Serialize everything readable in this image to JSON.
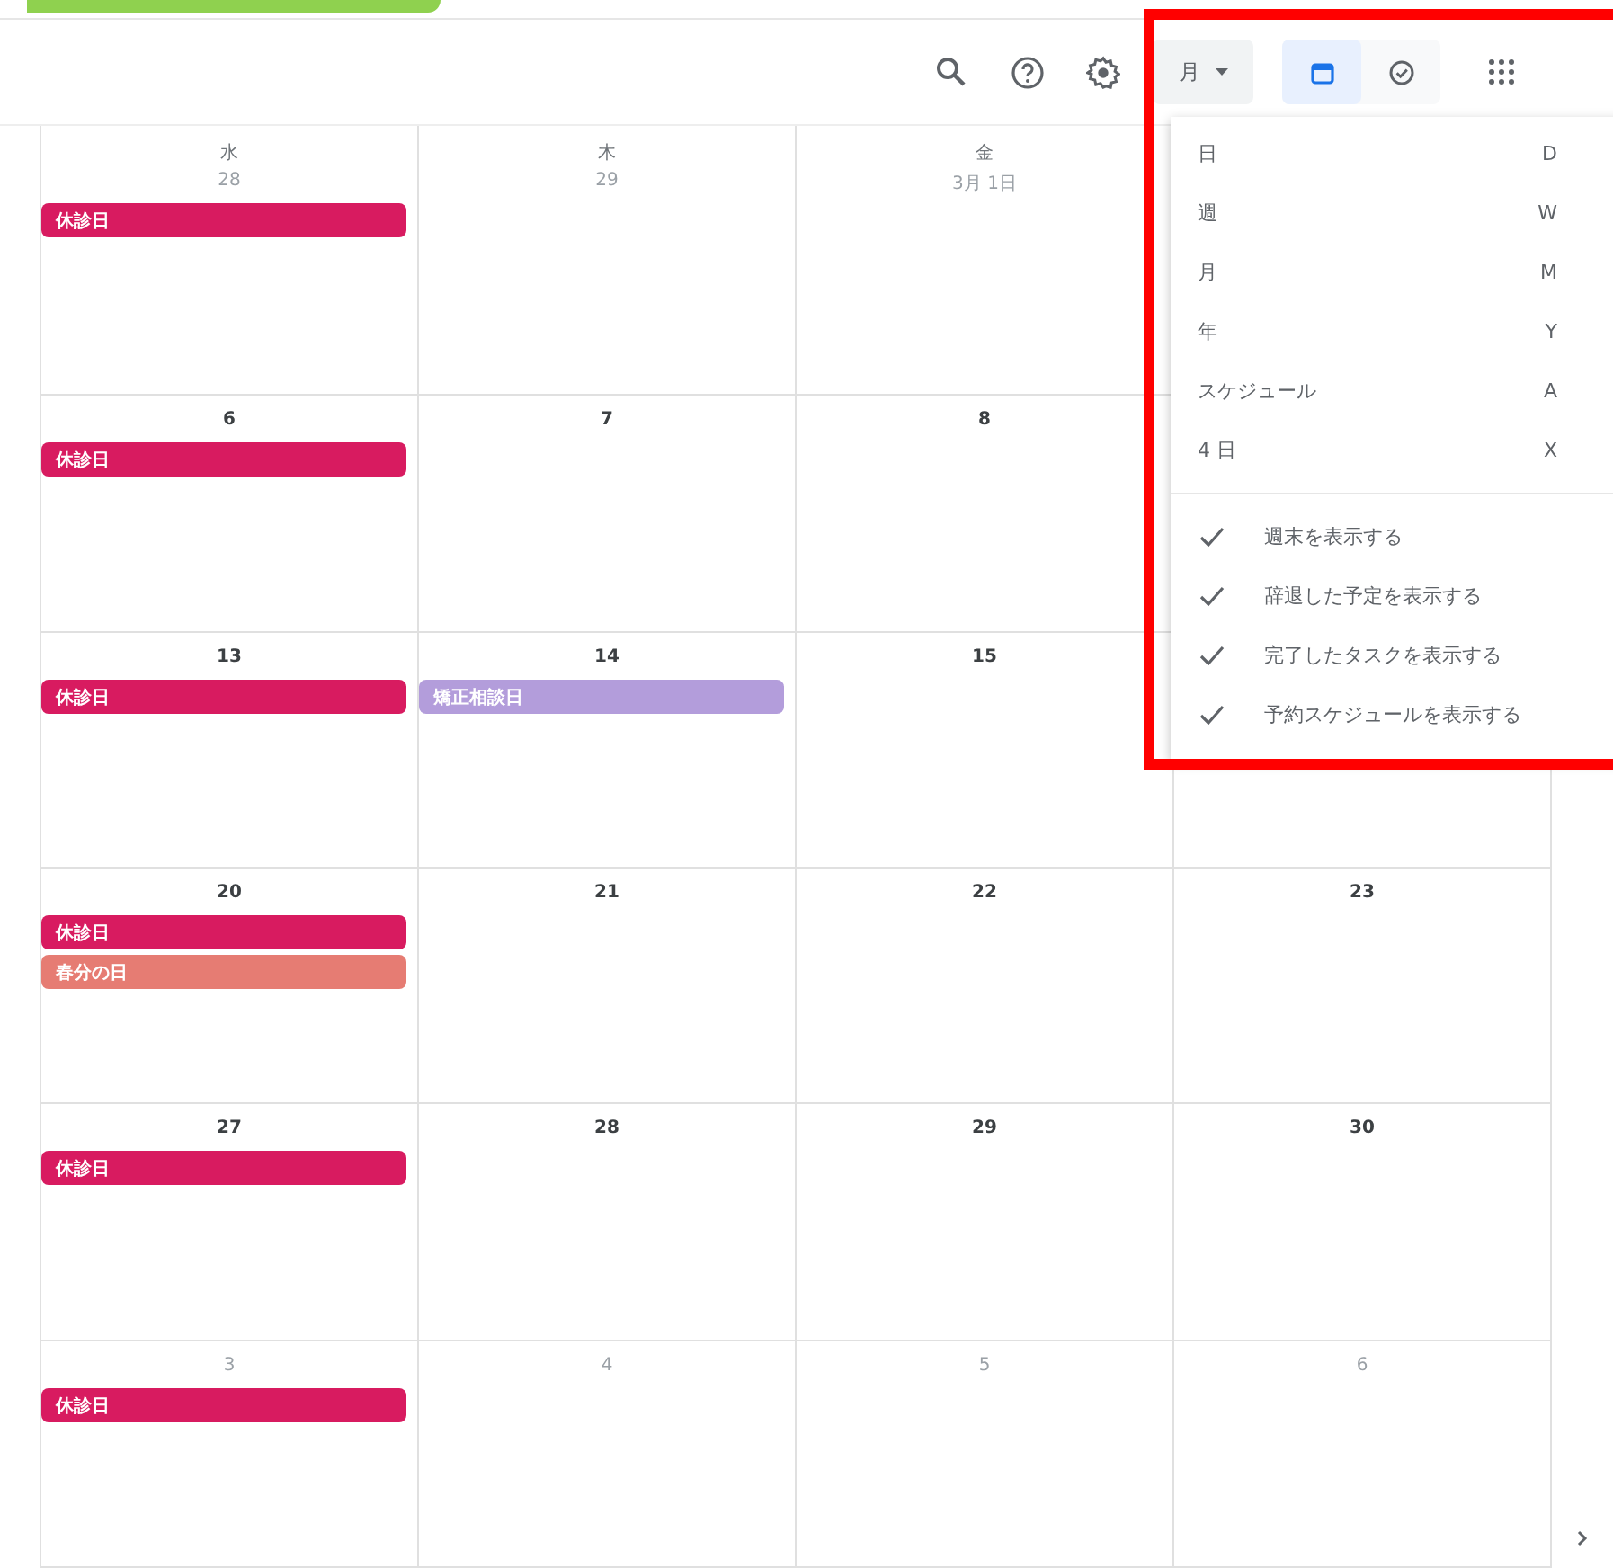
{
  "toolbar": {
    "view_button": {
      "label": "月"
    },
    "view_toggle": [
      {
        "kind": "calendar",
        "selected": true
      },
      {
        "kind": "tasks",
        "selected": false
      }
    ]
  },
  "view_menu": {
    "views": [
      {
        "label": "日",
        "shortcut": "D"
      },
      {
        "label": "週",
        "shortcut": "W"
      },
      {
        "label": "月",
        "shortcut": "M"
      },
      {
        "label": "年",
        "shortcut": "Y"
      },
      {
        "label": "スケジュール",
        "shortcut": "A"
      },
      {
        "label": "4 日",
        "shortcut": "X"
      }
    ],
    "options": [
      {
        "label": "週末を表示する",
        "checked": true
      },
      {
        "label": "辞退した予定を表示する",
        "checked": true
      },
      {
        "label": "完了したタスクを表示する",
        "checked": true
      },
      {
        "label": "予約スケジュールを表示する",
        "checked": true
      }
    ]
  },
  "calendar": {
    "weekdays": [
      "水",
      "木",
      "金"
    ],
    "weeks": [
      {
        "days": [
          {
            "date": "28",
            "dim": true,
            "events": [
              {
                "title": "休診日",
                "color": "#d81b60"
              }
            ]
          },
          {
            "date": "29",
            "dim": true
          },
          {
            "date": "3月 1日",
            "dim": true
          }
        ]
      },
      {
        "days": [
          {
            "date": "6",
            "dim": false,
            "events": [
              {
                "title": "休診日",
                "color": "#d81b60"
              }
            ]
          },
          {
            "date": "7",
            "dim": false
          },
          {
            "date": "8",
            "dim": false
          }
        ]
      },
      {
        "days": [
          {
            "date": "13",
            "dim": false,
            "events": [
              {
                "title": "休診日",
                "color": "#d81b60"
              }
            ]
          },
          {
            "date": "14",
            "dim": false,
            "events": [
              {
                "title": "矯正相談日",
                "color": "#b39ddb"
              }
            ]
          },
          {
            "date": "15",
            "dim": false
          }
        ]
      },
      {
        "days": [
          {
            "date": "20",
            "dim": false,
            "events": [
              {
                "title": "休診日",
                "color": "#d81b60"
              },
              {
                "title": "春分の日",
                "color": "#e67c73"
              }
            ]
          },
          {
            "date": "21",
            "dim": false
          },
          {
            "date": "22",
            "dim": false
          },
          {
            "date": "23",
            "dim": false
          }
        ]
      },
      {
        "days": [
          {
            "date": "27",
            "dim": false,
            "events": [
              {
                "title": "休診日",
                "color": "#d81b60"
              }
            ]
          },
          {
            "date": "28",
            "dim": false
          },
          {
            "date": "29",
            "dim": false
          },
          {
            "date": "30",
            "dim": false
          }
        ]
      },
      {
        "days": [
          {
            "date": "3",
            "dim": true,
            "events": [
              {
                "title": "休診日",
                "color": "#d81b60"
              }
            ]
          },
          {
            "date": "4",
            "dim": true
          },
          {
            "date": "5",
            "dim": true
          },
          {
            "date": "6",
            "dim": true
          }
        ]
      }
    ]
  }
}
